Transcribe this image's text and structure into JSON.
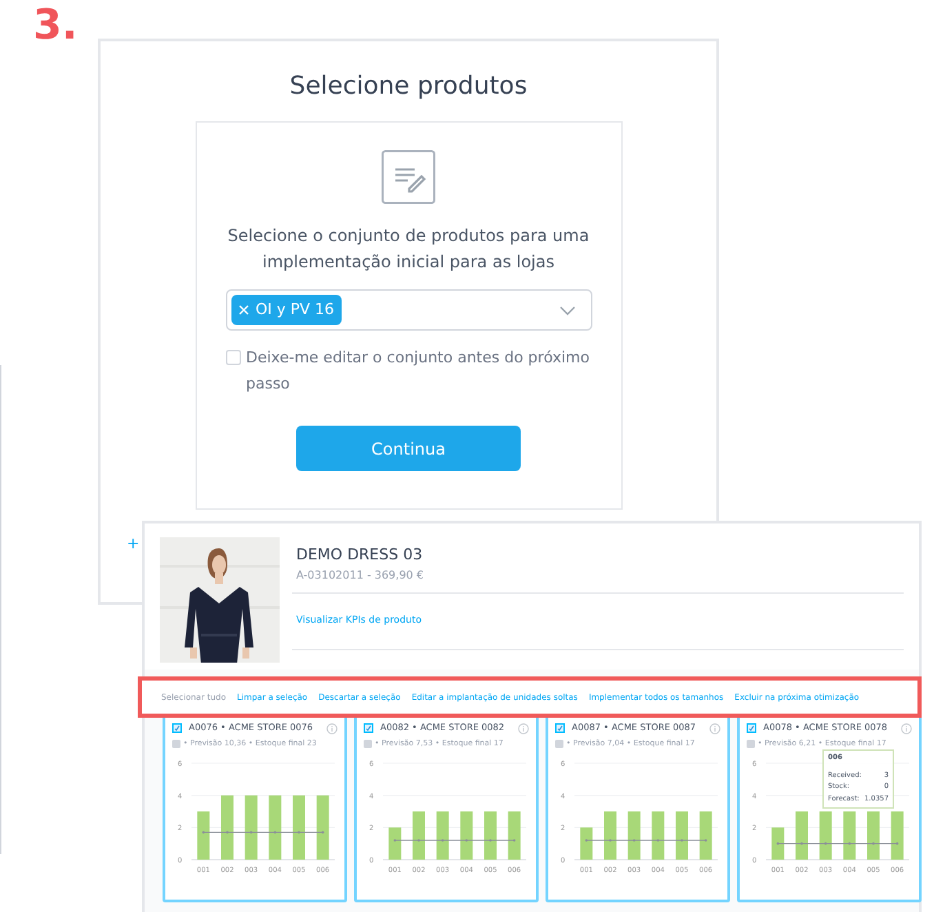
{
  "step_label": "3.",
  "dialog": {
    "title": "Selecione produtos",
    "description": "Selecione o conjunto de produtos para uma implementação inicial para as lojas",
    "tags": [
      {
        "label": "OI y PV 16"
      }
    ],
    "edit_option": {
      "label": "Deixe-me editar o conjunto antes do próximo passo",
      "checked": false
    },
    "button": "Continua"
  },
  "background_plus": "+",
  "product": {
    "name": "DEMO DRESS 03",
    "sku_price": "A-03102011 - 369,90 €",
    "kpi_link": "Visualizar KPIs de produto"
  },
  "actions": [
    {
      "label": "Selecionar tudo",
      "disabled": true
    },
    {
      "label": "Limpar a seleção",
      "disabled": false
    },
    {
      "label": "Descartar a seleção",
      "disabled": false
    },
    {
      "label": "Editar a implantação de unidades soltas",
      "disabled": false
    },
    {
      "label": "Implementar todos os tamanhos",
      "disabled": false
    },
    {
      "label": "Excluir na próxima otimização",
      "disabled": false
    }
  ],
  "stores": [
    {
      "title": "A0076 • ACME STORE 0076",
      "subtitle": "• Previsão 10,36 • Estoque final 23",
      "checked": true,
      "chart_data": {
        "type": "bar",
        "categories": [
          "001",
          "002",
          "003",
          "004",
          "005",
          "006"
        ],
        "ylim": [
          0,
          6
        ],
        "yticks": [
          0,
          2,
          4,
          6
        ],
        "series": [
          {
            "type": "bar",
            "color": "#a8d878",
            "values": [
              3,
              4,
              4,
              4,
              4,
              4
            ]
          },
          {
            "type": "line",
            "color": "#8a8f98",
            "values": [
              1.7,
              1.7,
              1.7,
              1.7,
              1.7,
              1.7
            ]
          }
        ]
      }
    },
    {
      "title": "A0082 • ACME STORE 0082",
      "subtitle": "• Previsão 7,53 • Estoque final 17",
      "checked": true,
      "chart_data": {
        "type": "bar",
        "categories": [
          "001",
          "002",
          "003",
          "004",
          "005",
          "006"
        ],
        "ylim": [
          0,
          6
        ],
        "yticks": [
          0,
          2,
          4,
          6
        ],
        "series": [
          {
            "type": "bar",
            "color": "#a8d878",
            "values": [
              2,
              3,
              3,
              3,
              3,
              3
            ]
          },
          {
            "type": "line",
            "color": "#8a8f98",
            "values": [
              1.2,
              1.2,
              1.2,
              1.2,
              1.2,
              1.2
            ]
          }
        ]
      }
    },
    {
      "title": "A0087 • ACME STORE 0087",
      "subtitle": "• Previsão 7,04 • Estoque final 17",
      "checked": true,
      "chart_data": {
        "type": "bar",
        "categories": [
          "001",
          "002",
          "003",
          "004",
          "005",
          "006"
        ],
        "ylim": [
          0,
          6
        ],
        "yticks": [
          0,
          2,
          4,
          6
        ],
        "series": [
          {
            "type": "bar",
            "color": "#a8d878",
            "values": [
              2,
              3,
              3,
              3,
              3,
              3
            ]
          },
          {
            "type": "line",
            "color": "#8a8f98",
            "values": [
              1.2,
              1.2,
              1.2,
              1.2,
              1.2,
              1.2
            ]
          }
        ]
      }
    },
    {
      "title": "A0078 • ACME STORE 0078",
      "subtitle": "• Previsão 6,21 • Estoque final 17",
      "checked": true,
      "chart_data": {
        "type": "bar",
        "categories": [
          "001",
          "002",
          "003",
          "004",
          "005",
          "006"
        ],
        "ylim": [
          0,
          6
        ],
        "yticks": [
          0,
          2,
          4,
          6
        ],
        "series": [
          {
            "type": "bar",
            "color": "#a8d878",
            "values": [
              2,
              3,
              3,
              3,
              3,
              3
            ]
          },
          {
            "type": "line",
            "color": "#8a8f98",
            "values": [
              1.0,
              1.0,
              1.0,
              1.0,
              1.0,
              1.0
            ]
          }
        ]
      },
      "tooltip": {
        "title": "006",
        "rows": [
          {
            "label": "Received:",
            "value": "3"
          },
          {
            "label": "Stock:",
            "value": "0"
          },
          {
            "label": "Forecast:",
            "value": "1.0357"
          }
        ]
      }
    }
  ]
}
